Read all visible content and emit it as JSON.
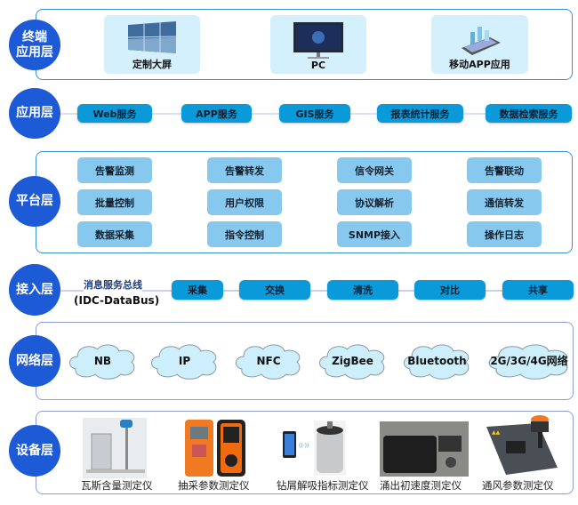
{
  "layers": {
    "terminal": {
      "label": "终端\n应用层",
      "items": [
        "定制大屏",
        "PC",
        "移动APP应用"
      ]
    },
    "application": {
      "label": "应用层",
      "items": [
        "Web服务",
        "APP服务",
        "GIS服务",
        "报表统计服务",
        "数据检索服务"
      ]
    },
    "platform": {
      "label": "平台层",
      "items": [
        [
          "告警监测",
          "告警转发",
          "信令网关",
          "告警联动"
        ],
        [
          "批量控制",
          "用户权限",
          "协议解析",
          "通信转发"
        ],
        [
          "数据采集",
          "指令控制",
          "SNMP接入",
          "操作日志"
        ]
      ]
    },
    "access": {
      "label": "接入层",
      "bus_title": "消息服务总线",
      "bus_subtitle": "(IDC-DataBus)",
      "items": [
        "采集",
        "交换",
        "清洗",
        "对比",
        "共享"
      ]
    },
    "network": {
      "label": "网络层",
      "items": [
        "NB",
        "IP",
        "NFC",
        "ZigBee",
        "Bluetooth",
        "2G/3G/4G网络"
      ]
    },
    "device": {
      "label": "设备层",
      "items": [
        "瓦斯含量测定仪",
        "抽采参数测定仪",
        "钻屑解吸指标测定仪",
        "涌出初速度测定仪",
        "通风参数测定仪"
      ]
    }
  },
  "colors": {
    "layer_circle": "#1d5ad6",
    "service_pill": "#0b9ad9",
    "platform_card": "#87c9ee",
    "terminal_card": "#d3f0fc",
    "cloud": "#cdeffc"
  }
}
